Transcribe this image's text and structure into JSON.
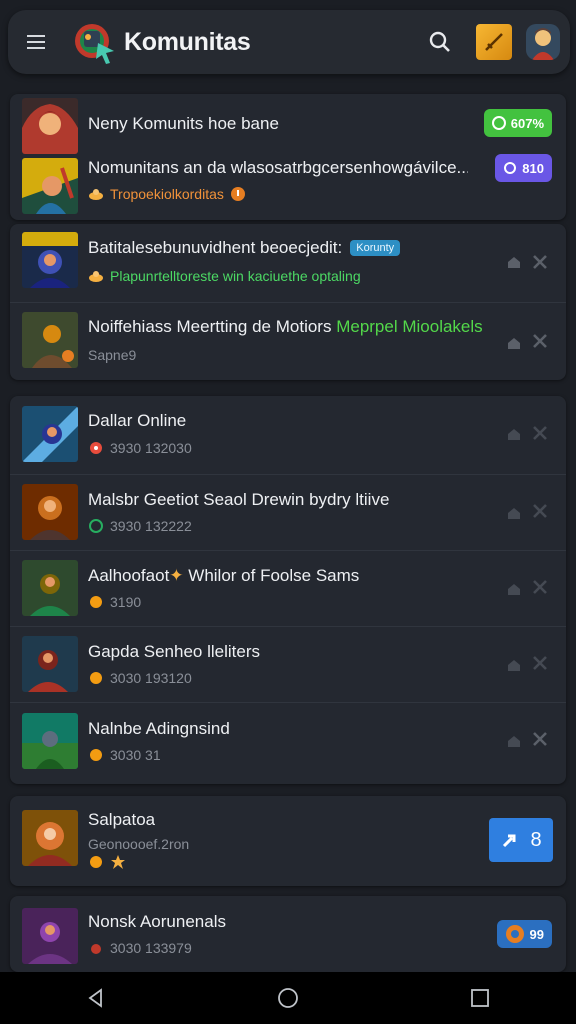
{
  "app": {
    "title": "Komunitas"
  },
  "group1": [
    {
      "title": "Neny Komunits hoe bane",
      "badge": "607%",
      "badge_color": "#43c23f"
    },
    {
      "title": "Nomunitans an da wlasosatrbgcersenhowgávilce...",
      "sub": "Tropoekiolkorditas",
      "badge": "810",
      "badge_color": "#6a57e6"
    }
  ],
  "group2": [
    {
      "title": "Batitalesebunuvidhent beoecjedit:",
      "tag": "Korunty",
      "sub": "Plapunrtelltoreste win kaciuethe optaling"
    },
    {
      "title": "Noiffehiass Meertting de Motiors",
      "title_green": "Meprpel Mioolakels",
      "sub": "Sapne9"
    }
  ],
  "group3": [
    {
      "title": "Dallar Online",
      "sub": "3930 132030"
    },
    {
      "title": "Malsbr Geetiot Seaol Drewin bydry ltiive",
      "sub": "3930 132222"
    },
    {
      "title": "Aalhoofaot",
      "title_rest": "Whilor of Foolse Sams",
      "sub": "3190"
    },
    {
      "title": "Gapda Senheo lleliters",
      "sub": "3030 193120"
    },
    {
      "title": "Nalnbe Adingnsind",
      "sub": "3030 31"
    }
  ],
  "group4": {
    "title": "Salpatoa",
    "sub": "Geonoooef.2ron",
    "button_count": "8"
  },
  "group5": {
    "title": "Nonsk Aorunenals",
    "sub": "3030 133979",
    "badge": "99"
  },
  "colors": {
    "background": "#1b1e24",
    "card": "#242830",
    "accent_blue": "#2f7fe0",
    "accent_green": "#43c23f"
  },
  "icons": [
    "menu-icon",
    "search-icon",
    "home-icon",
    "back-icon",
    "recents-icon",
    "pin-icon",
    "close-icon"
  ]
}
